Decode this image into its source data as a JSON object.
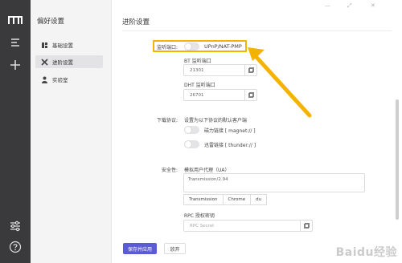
{
  "colors": {
    "rail": "#3a3a3d",
    "accent": "#5b5bd6",
    "highlight": "#f3b300",
    "sidebar_bg": "#f4f4f5"
  },
  "sidebar": {
    "title": "偏好设置",
    "items": [
      {
        "label": "基础设置",
        "icon": "basic-settings-icon"
      },
      {
        "label": "进阶设置",
        "icon": "advanced-settings-icon"
      },
      {
        "label": "实验室",
        "icon": "lab-icon"
      }
    ]
  },
  "main": {
    "title": "进阶设置",
    "listen_port": {
      "label": "监听端口:",
      "upnp_label": "UPnP/NAT-PMP",
      "upnp_enabled": false,
      "bt_label": "BT 监听端口",
      "bt_value": "21301",
      "dht_label": "DHT 监听端口",
      "dht_value": "26701"
    },
    "download_protocol": {
      "label": "下载协议:",
      "desc": "设置为以下协议的默认客户端",
      "magnet_label": "磁力链接 [ magnet:// ]",
      "magnet_enabled": false,
      "thunder_label": "迅雷链接 [ thunder:// ]",
      "thunder_enabled": false
    },
    "security": {
      "label": "安全性:",
      "ua_label": "模拟用户代理（UA）",
      "ua_value": "Transmission/2.94",
      "ua_presets": [
        "Transmission",
        "Chrome",
        "du"
      ],
      "rpc_label": "RPC 授权密钥",
      "rpc_placeholder": "RPC Secret"
    },
    "save_label": "保存并应用",
    "discard_label": "放弃"
  },
  "watermark": "Baidu经验"
}
